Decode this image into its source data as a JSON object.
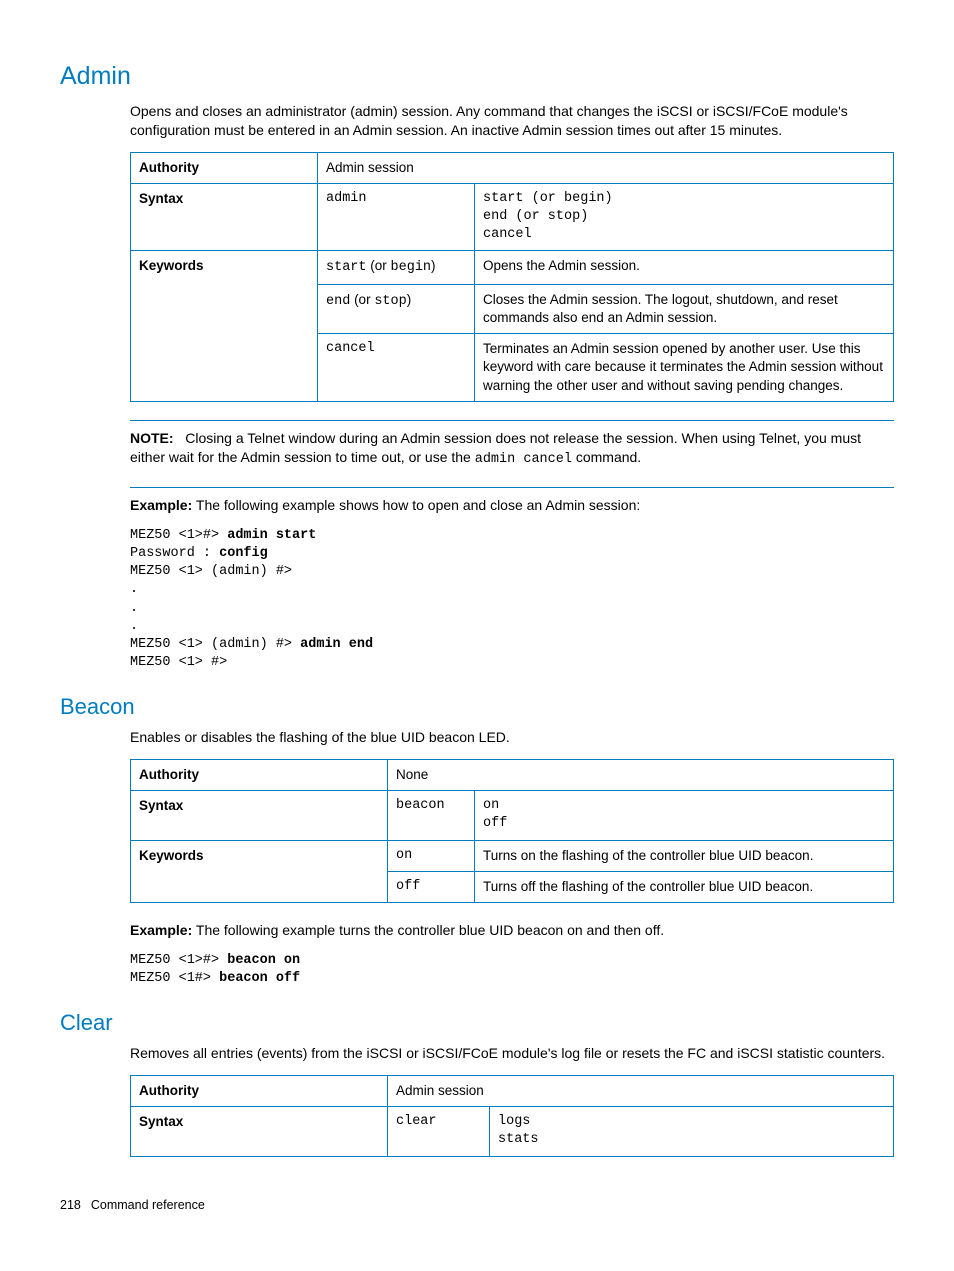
{
  "admin": {
    "heading": "Admin",
    "intro": "Opens and closes an administrator (admin) session. Any command that changes the iSCSI or iSCSI/FCoE module's configuration must be entered in an Admin session. An inactive Admin session times out after 15 minutes.",
    "table": {
      "authority_label": "Authority",
      "authority_val": "Admin session",
      "syntax_label": "Syntax",
      "syntax_cmd": "admin",
      "syntax_args": "start (or begin)\nend (or stop)\ncancel",
      "keywords_label": "Keywords",
      "kw1_cmd_a": "start",
      "kw1_or": " (or ",
      "kw1_cmd_b": "begin",
      "kw1_close": ")",
      "kw1_desc": "Opens the Admin session.",
      "kw2_cmd_a": "end",
      "kw2_or": " (or ",
      "kw2_cmd_b": "stop",
      "kw2_close": ")",
      "kw2_desc": "Closes the Admin session. The logout, shutdown, and reset commands also end an Admin session.",
      "kw3_cmd": "cancel",
      "kw3_desc": "Terminates an Admin session opened by another user. Use this keyword with care because it terminates the Admin session without warning the other user and without saving pending changes."
    },
    "note_label": "NOTE:",
    "note_text_a": "Closing a Telnet window during an Admin session does not release the session. When using Telnet, you must either wait for the Admin session to time out, or use the ",
    "note_code": "admin cancel",
    "note_text_b": " command.",
    "example_label": "Example:",
    "example_text": " The following example shows how to open and close an Admin session:",
    "code": {
      "l1a": "MEZ50 <1>#> ",
      "l1b": "admin start",
      "l2a": "Password : ",
      "l2b": "config",
      "l3": "MEZ50 <1> (admin) #>",
      "l4": ".",
      "l5": ".",
      "l6": ".",
      "l7a": "MEZ50 <1> (admin) #> ",
      "l7b": "admin end",
      "l8": "MEZ50 <1> #>"
    }
  },
  "beacon": {
    "heading": "Beacon",
    "intro": "Enables or disables the flashing of the blue UID beacon LED.",
    "table": {
      "authority_label": "Authority",
      "authority_val": "None",
      "syntax_label": "Syntax",
      "syntax_cmd": "beacon",
      "syntax_args": "on\noff",
      "keywords_label": "Keywords",
      "kw1_cmd": "on",
      "kw1_desc": "Turns on the flashing of the controller blue UID beacon.",
      "kw2_cmd": "off",
      "kw2_desc": "Turns off the flashing of the controller blue UID beacon."
    },
    "example_label": "Example:",
    "example_text": " The following example turns the controller blue UID beacon on and then off.",
    "code": {
      "l1a": "MEZ50 <1>#> ",
      "l1b": "beacon on",
      "l2a": "MEZ50 <1#> ",
      "l2b": "beacon off"
    }
  },
  "clear": {
    "heading": "Clear",
    "intro": "Removes all entries (events) from the iSCSI or iSCSI/FCoE module's log file or resets the FC and iSCSI statistic counters.",
    "table": {
      "authority_label": "Authority",
      "authority_val": "Admin session",
      "syntax_label": "Syntax",
      "syntax_cmd": "clear",
      "syntax_args": "logs\nstats"
    }
  },
  "footer": {
    "page": "218",
    "title": "Command reference"
  }
}
